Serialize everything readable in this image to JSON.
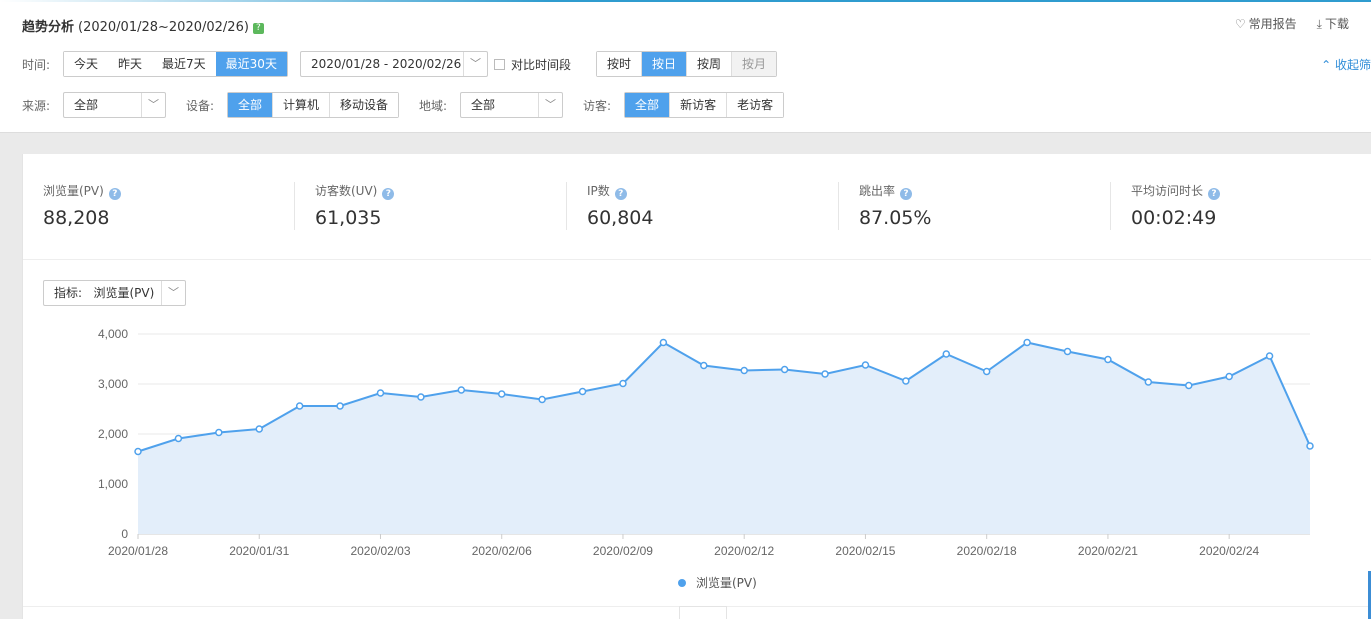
{
  "header": {
    "title": "趋势分析",
    "range": "(2020/01/28~2020/02/26)",
    "help_badge": "?",
    "links": [
      {
        "icon": "heart-icon",
        "label": "常用报告"
      },
      {
        "icon": "download-icon",
        "label": "下载"
      }
    ],
    "collapse_label": "收起筛"
  },
  "filters": {
    "time_label": "时间:",
    "time_options": [
      "今天",
      "昨天",
      "最近7天",
      "最近30天"
    ],
    "time_selected": "最近30天",
    "date_range": "2020/01/28 - 2020/02/26",
    "compare_label": "对比时间段",
    "granularity": [
      "按时",
      "按日",
      "按周",
      "按月"
    ],
    "granularity_selected": "按日",
    "granularity_disabled": "按月",
    "source_label": "来源:",
    "source_value": "全部",
    "device_label": "设备:",
    "device_options": [
      "全部",
      "计算机",
      "移动设备"
    ],
    "region_label": "地域:",
    "region_value": "全部",
    "visitor_label": "访客:",
    "visitor_options": [
      "全部",
      "新访客",
      "老访客"
    ]
  },
  "metrics": [
    {
      "label": "浏览量(PV)",
      "value": "88,208"
    },
    {
      "label": "访客数(UV)",
      "value": "61,035"
    },
    {
      "label": "IP数",
      "value": "60,804"
    },
    {
      "label": "跳出率",
      "value": "87.05%"
    },
    {
      "label": "平均访问时长",
      "value": "00:02:49"
    }
  ],
  "indicator": {
    "label": "指标:",
    "value": "浏览量(PV)"
  },
  "colors": {
    "accent": "#4fa1ec",
    "area": "#e3eefa",
    "line": "#4fa1ec"
  },
  "chart_data": {
    "type": "area",
    "series": [
      {
        "name": "浏览量(PV)",
        "values": [
          1650,
          1910,
          2030,
          2100,
          2560,
          2560,
          2820,
          2740,
          2880,
          2800,
          2690,
          2850,
          3010,
          3830,
          3370,
          3270,
          3290,
          3200,
          3380,
          3060,
          3600,
          3250,
          3830,
          3650,
          3490,
          3040,
          2970,
          3150,
          3560,
          1760
        ]
      }
    ],
    "x": [
      "2020/01/28",
      "2020/01/29",
      "2020/01/30",
      "2020/01/31",
      "2020/02/01",
      "2020/02/02",
      "2020/02/03",
      "2020/02/04",
      "2020/02/05",
      "2020/02/06",
      "2020/02/07",
      "2020/02/08",
      "2020/02/09",
      "2020/02/10",
      "2020/02/11",
      "2020/02/12",
      "2020/02/13",
      "2020/02/14",
      "2020/02/15",
      "2020/02/16",
      "2020/02/17",
      "2020/02/18",
      "2020/02/19",
      "2020/02/20",
      "2020/02/21",
      "2020/02/22",
      "2020/02/23",
      "2020/02/24",
      "2020/02/25",
      "2020/02/26"
    ],
    "x_tick_labels": [
      "2020/01/28",
      "2020/01/31",
      "2020/02/03",
      "2020/02/06",
      "2020/02/09",
      "2020/02/12",
      "2020/02/15",
      "2020/02/18",
      "2020/02/21",
      "2020/02/24"
    ],
    "y_ticks": [
      "0",
      "1,000",
      "2,000",
      "3,000",
      "4,000"
    ],
    "ylim": [
      0,
      4000
    ],
    "grid": true,
    "legend": "bottom-center"
  }
}
